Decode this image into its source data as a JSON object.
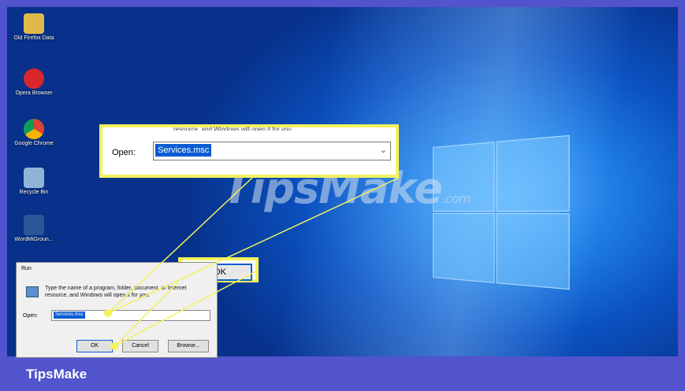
{
  "desktop_icons": [
    {
      "label": "Old Firefox Data",
      "color": "#e0b84a"
    },
    {
      "label": "Opera Browser",
      "color": "#d9262c"
    },
    {
      "label": "Google Chrome",
      "color": "#3b9b3f"
    },
    {
      "label": "Recycle Bin",
      "color": "#8fb4d8"
    },
    {
      "label": "WordMiGroun...",
      "color": "#2b5797"
    }
  ],
  "zoom": {
    "cut_text": "resource, and Windows will open it for you.",
    "open_label": "Open:",
    "value": "Services.msc",
    "ok_label": "OK"
  },
  "run_dialog": {
    "title": "Run",
    "description": "Type the name of a program, folder, document, or Internet resource, and Windows will open it for you.",
    "open_label": "Open:",
    "value": "Services.msc",
    "ok": "OK",
    "cancel": "Cancel",
    "browse": "Browse..."
  },
  "watermark": {
    "main": "TipsMake",
    "suffix": ".com"
  },
  "footer": {
    "brand": "TipsMake"
  },
  "colors": {
    "highlight": "#f4f25d",
    "frame": "#5154cc",
    "selection": "#0b5cd1"
  }
}
